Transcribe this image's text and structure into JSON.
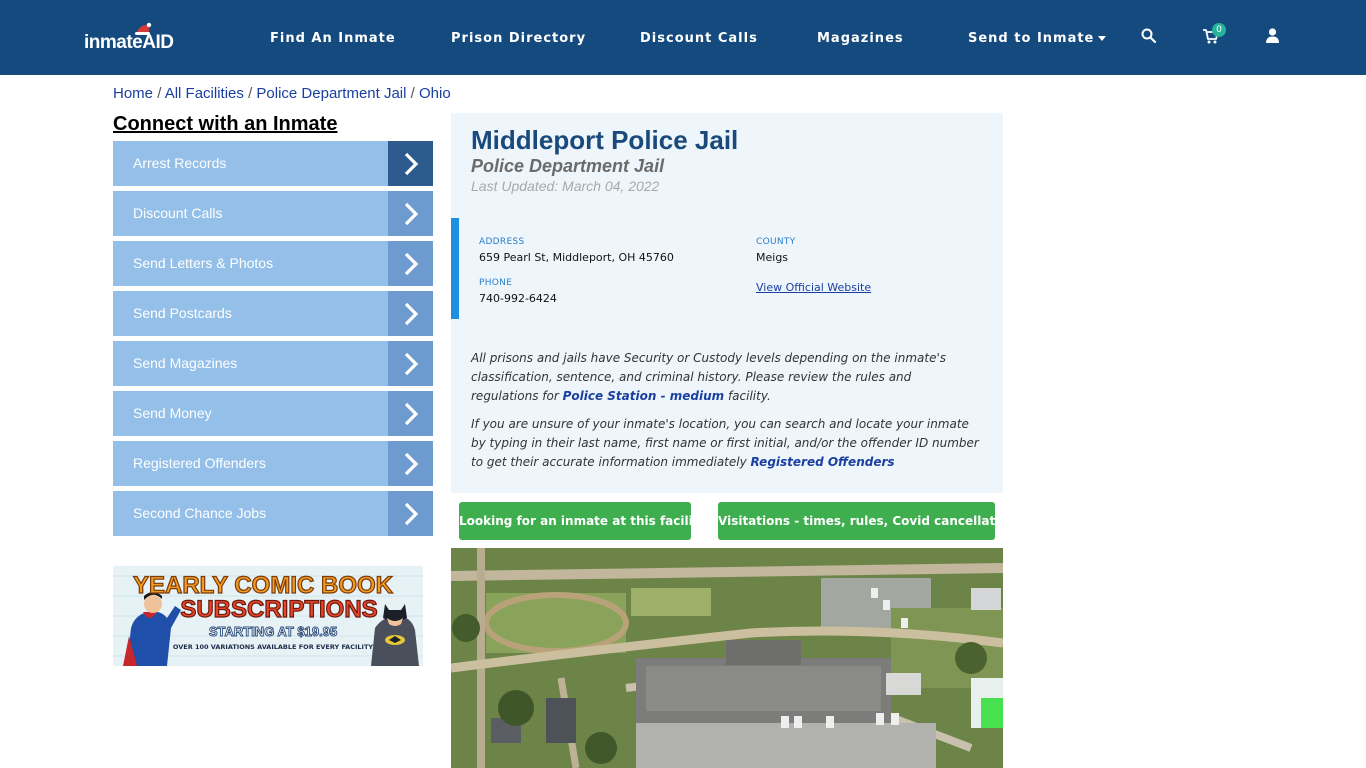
{
  "header": {
    "logo_text": "inmateAID",
    "nav": [
      {
        "label": "Find An Inmate"
      },
      {
        "label": "Prison Directory"
      },
      {
        "label": "Discount Calls"
      },
      {
        "label": "Magazines"
      },
      {
        "label": "Send to Inmate"
      }
    ],
    "cart_count": "0",
    "icons": {
      "search": "search-icon",
      "cart": "cart-icon",
      "user": "user-icon",
      "dropdown": "caret-down-icon"
    }
  },
  "breadcrumb": {
    "items": [
      "Home",
      "All Facilities",
      "Police Department Jail",
      "Ohio"
    ],
    "separator": "/"
  },
  "sidebar": {
    "title": "Connect with an Inmate",
    "items": [
      {
        "label": "Arrest Records"
      },
      {
        "label": "Discount Calls"
      },
      {
        "label": "Send Letters & Photos"
      },
      {
        "label": "Send Postcards"
      },
      {
        "label": "Send Magazines"
      },
      {
        "label": "Send Money"
      },
      {
        "label": "Registered Offenders"
      },
      {
        "label": "Second Chance Jobs"
      }
    ],
    "banner": {
      "line1": "YEARLY COMIC BOOK",
      "line2": "SUBSCRIPTIONS",
      "line3": "STARTING AT $19.95",
      "line4": "OVER 100 VARIATIONS AVAILABLE FOR EVERY FACILITY"
    }
  },
  "facility": {
    "name": "Middleport Police Jail",
    "type": "Police Department Jail",
    "updated": "Last Updated: March 04, 2022",
    "address_label": "ADDRESS",
    "address": "659 Pearl St, Middleport, OH 45760",
    "county_label": "COUNTY",
    "county": "Meigs",
    "phone_label": "PHONE",
    "phone": "740-992-6424",
    "website_link": "View Official Website",
    "para1_pre": "All prisons and jails have Security or Custody levels depending on the inmate's classification, sentence, and criminal history. Please review the rules and regulations for ",
    "para1_link": "Police Station - medium",
    "para1_post": " facility.",
    "para2_pre": "If you are unsure of your inmate's location, you can search and locate your inmate by typing in their last name, first name or first initial, and/or the offender ID number to get their accurate information immediately ",
    "para2_link": "Registered Offenders"
  },
  "buttons": {
    "looking": "Looking for an inmate at this facility?",
    "visitations": "Visitations - times, rules, Covid cancellations"
  },
  "colors": {
    "header_bg": "#144a7e",
    "menu_bg": "#93bfe8",
    "menu_arrow": "#6e9bcf",
    "menu_arrow_active": "#2d5b8e",
    "title": "#1a4a7c",
    "accent_bar": "#1e90e0",
    "green_button": "#3fae4f",
    "cart_badge": "#25b39a"
  }
}
